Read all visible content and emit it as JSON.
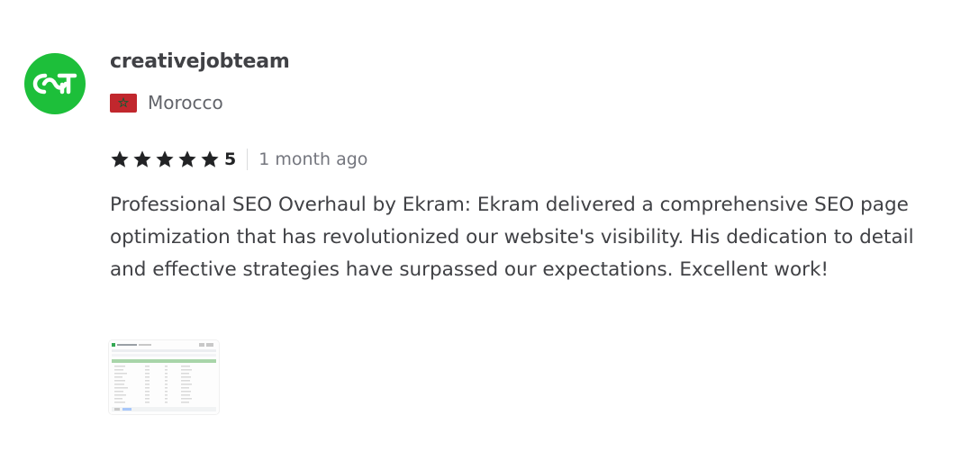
{
  "reviewer": {
    "username": "creativejobteam",
    "avatar_initials": "cjt",
    "avatar_color": "#1dbf3a",
    "avatar_icon": "cjt-logo-icon",
    "country": "Morocco",
    "flag_colors": {
      "red": "#c1272d",
      "star": "#006233"
    }
  },
  "rating": {
    "stars": 5,
    "score_label": "5",
    "star_color": "#222325",
    "time_ago": "1 month ago"
  },
  "review_text": "Professional SEO Overhaul by Ekram: Ekram delivered a comprehensive SEO page optimization that has revolutionized our website's visibility. His dedication to detail and effective strategies have surpassed our expectations. Excellent work!",
  "attachment": {
    "type": "spreadsheet-screenshot-thumbnail",
    "accent_color": "#7cc47f"
  }
}
